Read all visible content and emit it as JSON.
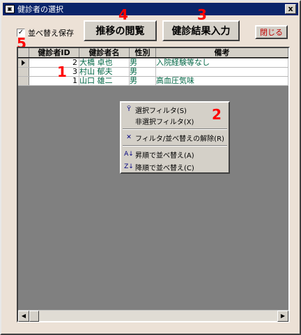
{
  "window": {
    "title": "健診者の選択",
    "system_icon": "app-icon",
    "close_glyph": "x"
  },
  "toolbar": {
    "sort_save_label": "並べ替え保存",
    "sort_save_checked": true,
    "history_button": "推移の閲覧",
    "result_input_button": "健診結果入力",
    "close_button": "閉じる"
  },
  "annotations": {
    "a1": "1",
    "a2": "2",
    "a3": "3",
    "a4": "4",
    "a5": "5"
  },
  "table": {
    "columns": [
      "健診者ID",
      "健診者名",
      "性別",
      "備考"
    ],
    "rows": [
      {
        "id": "2",
        "name": "大橋 卓也",
        "gender": "男",
        "note": "入院経験等なし",
        "current": true
      },
      {
        "id": "3",
        "name": "村山 郁夫",
        "gender": "男",
        "note": "",
        "current": false
      },
      {
        "id": "1",
        "name": "山口 雄二",
        "gender": "男",
        "note": "高血圧気味",
        "current": false
      }
    ]
  },
  "context_menu": {
    "items": [
      {
        "label": "選択フィルタ(S)",
        "icon": "filter-selection-icon"
      },
      {
        "label": "非選択フィルタ(X)",
        "icon": ""
      },
      {
        "label": "フィルタ/並べ替えの解除(R)",
        "icon": "remove-filter-icon"
      },
      {
        "label": "昇順で並べ替え(A)",
        "icon": "sort-ascending-icon"
      },
      {
        "label": "降順で並べ替え(C)",
        "icon": "sort-descending-icon"
      }
    ]
  },
  "colors": {
    "titlebar": "#0a246a",
    "annotation": "#ff0000",
    "grid_bg": "#808080",
    "window_bg": "#ece1d6"
  }
}
